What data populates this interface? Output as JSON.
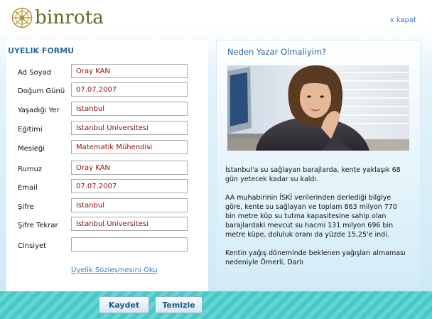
{
  "header": {
    "logo_text": "binrota",
    "close_link": "x kapat"
  },
  "form": {
    "title": "UYELIK FORMU",
    "fields": [
      {
        "label": "Ad Soyad",
        "value": "Oray KAN"
      },
      {
        "label": "Doğum Günü",
        "value": "07.07.2007"
      },
      {
        "label": "Yaşadığı Yer",
        "value": "İstanbul"
      },
      {
        "label": "Eğitimi",
        "value": "İstanbul Üniversitesi"
      },
      {
        "label": "Mesleği",
        "value": "Matematik Mühendisi"
      },
      {
        "label": "Rumuz",
        "value": "Oray KAN"
      },
      {
        "label": "Email",
        "value": "07.07.2007"
      },
      {
        "label": "Şifre",
        "value": "İstanbul"
      },
      {
        "label": "Şifre Tekrar",
        "value": "İstanbul Üniversitesi"
      },
      {
        "label": "Cinsiyet",
        "value": ""
      }
    ],
    "agreement_link": "Üyelik Sözleşmesini Oku"
  },
  "info": {
    "title": "Neden Yazar Olmaliyim?",
    "paragraphs": [
      "İstanbul'a su sağlayan barajlarda, kente yaklaşık 68 gün yetecek kadar su kaldı.",
      "AA muhabirinin İSKİ verilerinden derlediği bilgiye göre, kente su sağlayan ve toplam 863 milyon 770 bin metre küp su tutma kapasitesine sahip olan barajlardaki mevcut su hacmi 131 milyon 696 bin metre küpe, doluluk oranı da yüzde 15,25'e indi.",
      "Kentin yağış döneminde beklenen yağışları almaması nedeniyle Ömerli, Darlı"
    ]
  },
  "buttons": {
    "save": "Kaydet",
    "clear": "Temizle"
  },
  "colors": {
    "accent": "#2b6a9e",
    "link": "#3a7bbf",
    "value_text": "#8a1010",
    "footer": "#48c8c6"
  }
}
